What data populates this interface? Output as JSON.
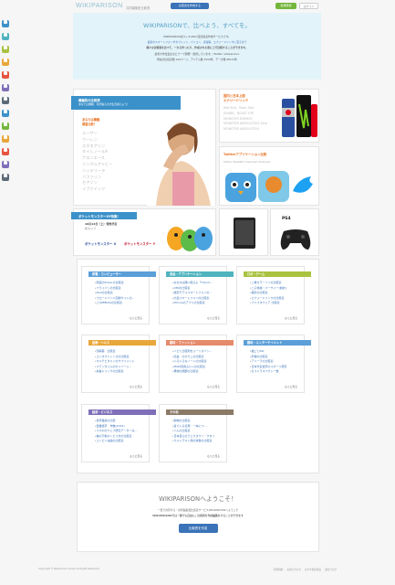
{
  "header": {
    "logo": "WIKIPARISON",
    "tagline": "共同編集型比較表",
    "create_btn": "比較表を作成する",
    "register_btn": "新規登録",
    "login_btn": "ログイン"
  },
  "hero": {
    "title": "WIKIPARISONで、比べよう、すべてを。",
    "lines": [
      "WIKIPARISONはウィキ(Wiki)型比較表作成サービスです。",
      "最新のスマートフォンやタブレット、パソコン、家電等、エナジードリンクに至るまで",
      "様々な比較表を比べて、一から作ったり、作成された表に上で比較することができます。",
      "最新大学生生比などナーで開発・運営しています。(Twitter: wikiparison)",
      "現在の比較表数 144ページ、アイテム数 3944件、データ数 98121件"
    ]
  },
  "featured_tablets": {
    "tab_title": "機種別の比較表",
    "tab_sub": "あなたは機種、何が撮るのが生活感じよう！",
    "subhead_lines": [
      "あなたは機種",
      "調査比較！"
    ],
    "items": [
      "ユーザー",
      "ウーレン",
      "エネモアリン",
      "タイレノールA",
      "ナロンエース",
      "リングルアイビー",
      "ハッキリーラ",
      "バファリン",
      "モアゾン",
      "イブクイック"
    ]
  },
  "energy_drink": {
    "head_lines": [
      "国内と日本上陸",
      "エナジードリンク"
    ],
    "items": [
      "Red Bull、Rock Star",
      "SHARK、BEAST EYE",
      "MONSTER ENERGY",
      "MONSTER ABSOLUTELY Zero",
      "MONSTER ABSOLUTELY"
    ]
  },
  "twitter_apps": {
    "head": "Twitterアプリケーション比較",
    "sub": "Twitter TweetBot Cashcast HootSuite"
  },
  "pokemon": {
    "tab_title": "ポケットモンスターXY特集！",
    "lines": [
      "10月12日（土）発売予定",
      "新タイプ"
    ],
    "game_x": "ポケットモンスター X",
    "game_y": "ポケットモンスター Y"
  },
  "ps4": {
    "label": "PS4"
  },
  "categories": [
    {
      "title": "家電・コンピューター",
      "color": "#5b9fd8",
      "items": [
        "家庭のPowerの比較表",
        "フライパンの比較表",
        "iPadの比較表",
        "ブロードバンド回線サイトの…",
        "ご(WEBOS)の比較表"
      ],
      "more": "もっと見る"
    },
    {
      "title": "食品・アプリケーション",
      "color": "#4fb3bf",
      "items": [
        "おなかは酸い極るよ「F4and…",
        "OMIの比較表",
        "格安モデルスマートフォンの…",
        "の皿スマートフォンの比較表",
        "iPhoneのアプリの比較表"
      ],
      "more": "もっと見る"
    },
    {
      "title": "ロボ・ゲーム",
      "color": "#a9c341",
      "items": [
        "二重ガラーソンの比較表",
        "二子供魔・パーサイー(前的)",
        "撮影の比較表",
        "エナジードリンクの比較表",
        "プリスタウェア 比較表"
      ],
      "more": "もっと見る"
    },
    {
      "title": "医療・ヘルス",
      "color": "#e8a73a",
      "items": [
        "頭痛薬　比較表",
        "コンタクトレンズの比較表",
        "マルチビタミンのサプリメント",
        "ステンダイムのセリゾーシ…",
        "栄養ドリンクの比較表"
      ],
      "more": "もっと見る"
    },
    {
      "title": "趣味・ファッション",
      "color": "#e58a6a",
      "items": [
        "ヘビに比較剤をジーンズバン…",
        "出金　のかりこの比較表",
        "いろいろなノートの比較表",
        "MGM自用ぶにいの比較表",
        "果物の細部の比較表"
      ],
      "more": "もっと見る"
    },
    {
      "title": "趣味・エンターテイメント",
      "color": "#5b9fd8",
      "items": [
        "猫ごとEat",
        "声優の比較表",
        "アニーラの比較表",
        "日本代表選手のスポーツ研究",
        "ガスドラマペクシー数"
      ],
      "more": "もっと見る"
    },
    {
      "title": "経済・ビジネス",
      "color": "#7f6fb8",
      "items": [
        "世界遺産の比較",
        "賞業選手　作数(2013)",
        "スマホのウェブ研究データーみ…",
        "株の不動ホンビス方の比較表",
        "コンビニ決議の比較表"
      ],
      "more": "もっと見る"
    },
    {
      "title": "その他",
      "color": "#8a7a66",
      "items": [
        "動物の比較表",
        "質でいる表現　一本につ…",
        "ヘムの比較表",
        "日本自らのうじりタウン・クタン",
        "ウルトラマン用の攻撃の比較表"
      ],
      "more": "もっと見る"
    }
  ],
  "welcome": {
    "title": "WIKIPARISONへようこそ！",
    "line1": "一度で共有する・共同編集型比較表サービスWIKIPARISONへようこそ",
    "line2": "WIKIPARISONでは「誰でも自由に」比較表を作成編集をすることができます",
    "button": "比較表を作成"
  },
  "footer": {
    "copyright": "Copyright © Wikiparison Group All Rights Reserved.",
    "links": [
      "利用規約",
      "お問い合わせ",
      "おすすめ比較表",
      "運営ブログ"
    ]
  },
  "side_icons": [
    {
      "name": "pc-icon",
      "color": "#3b91c9"
    },
    {
      "name": "tablet-icon",
      "color": "#4fb3bf"
    },
    {
      "name": "fork-icon",
      "color": "#a9c341"
    },
    {
      "name": "book-icon",
      "color": "#e8a73a"
    },
    {
      "name": "tag-icon",
      "color": "#e6533f"
    },
    {
      "name": "film-icon",
      "color": "#7f6fb8"
    },
    {
      "name": "bag-icon",
      "color": "#5b6a78"
    },
    {
      "name": "mobile-icon",
      "color": "#3b91c9"
    },
    {
      "name": "phone-icon",
      "color": "#74b63c"
    },
    {
      "name": "money-icon",
      "color": "#e8a73a"
    },
    {
      "name": "robot-icon",
      "color": "#e6533f"
    },
    {
      "name": "book2-icon",
      "color": "#7f6fb8"
    },
    {
      "name": "folder-icon",
      "color": "#5b6a78"
    }
  ]
}
